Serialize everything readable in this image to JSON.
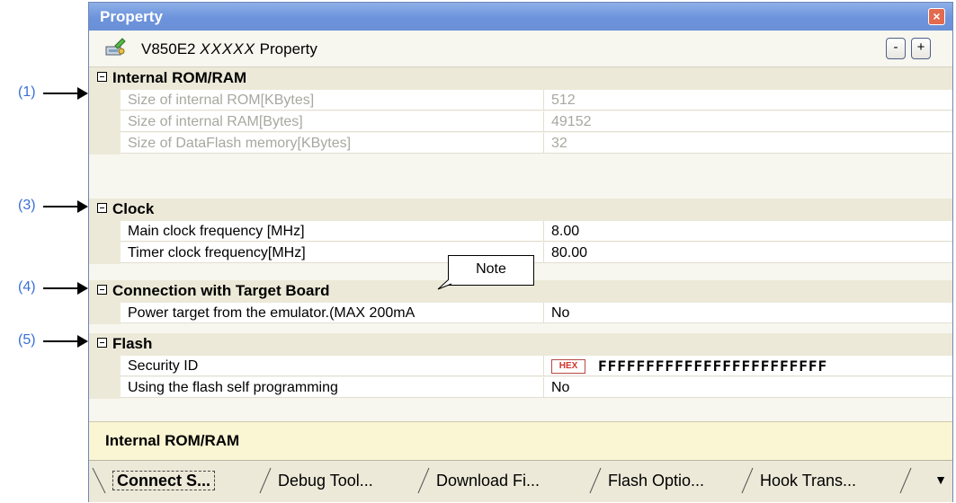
{
  "callouts": [
    "(1)",
    "(3)",
    "(4)",
    "(5)"
  ],
  "window": {
    "title": "Property",
    "close": "×"
  },
  "header": {
    "prefix": "V850E2 ",
    "model": "XXXXX",
    "suffix": " Property",
    "collapse_label": "-",
    "expand_label": "+"
  },
  "categories": {
    "rom": {
      "label": "Internal ROM/RAM",
      "rows": [
        {
          "name": "Size of internal ROM[KBytes]",
          "value": "512"
        },
        {
          "name": "Size of internal RAM[Bytes]",
          "value": "49152"
        },
        {
          "name": "Size of DataFlash memory[KBytes]",
          "value": "32"
        }
      ]
    },
    "clock": {
      "label": "Clock",
      "rows": [
        {
          "name": "Main clock frequency [MHz]",
          "value": "8.00"
        },
        {
          "name": "Timer clock frequency[MHz]",
          "value": "80.00"
        }
      ]
    },
    "connection": {
      "label": "Connection with Target Board",
      "rows": [
        {
          "name": "Power target from the emulator.(MAX 200mA",
          "value": "No"
        }
      ]
    },
    "flash": {
      "label": "Flash",
      "rows": [
        {
          "name": "Security ID",
          "badge": "HEX",
          "value": "FFFFFFFFFFFFFFFFFFFFFFFF"
        },
        {
          "name": "Using the flash self programming",
          "value": "No"
        }
      ]
    }
  },
  "note": "Note",
  "description": "Internal ROM/RAM",
  "tabs": [
    "Connect S...",
    "Debug Tool...",
    "Download Fi...",
    "Flash Optio...",
    "Hook Trans..."
  ],
  "overflow_icon": "▼"
}
